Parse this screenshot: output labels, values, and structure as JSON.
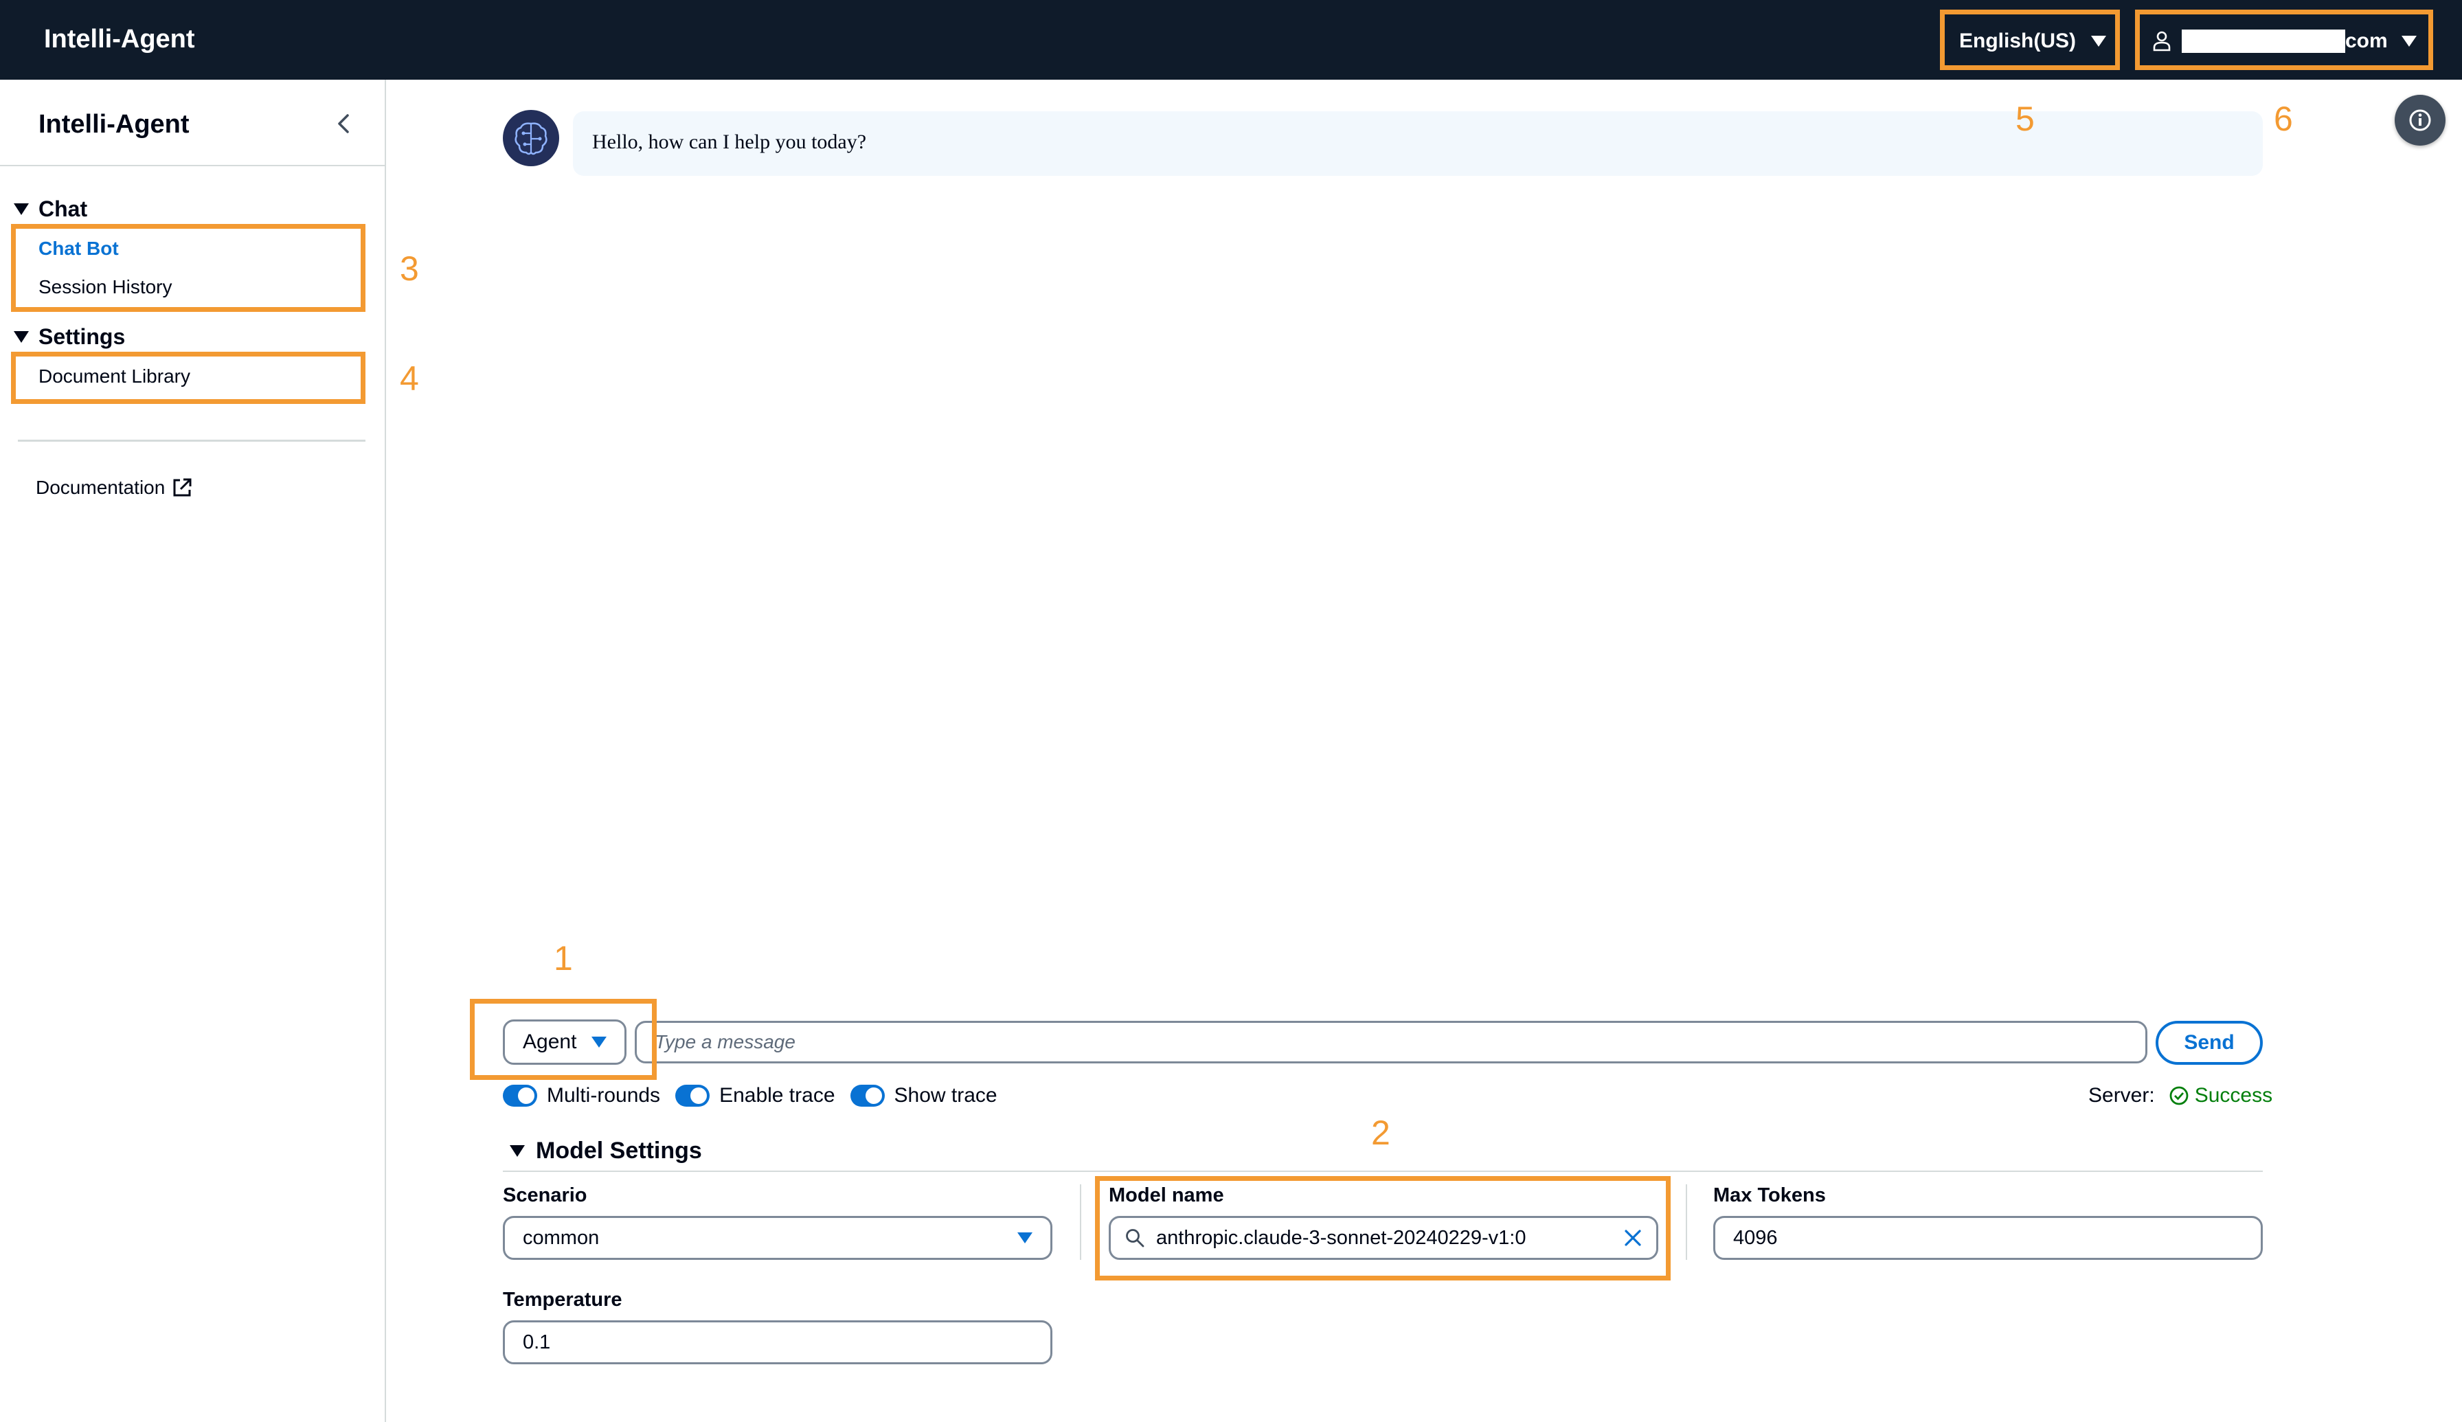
{
  "header": {
    "brand": "Intelli-Agent",
    "language": "English(US)",
    "user_suffix": "com"
  },
  "sidebar": {
    "title": "Intelli-Agent",
    "sections": [
      {
        "label": "Chat",
        "items": [
          {
            "label": "Chat Bot",
            "active": true
          },
          {
            "label": "Session History",
            "active": false
          }
        ]
      },
      {
        "label": "Settings",
        "items": [
          {
            "label": "Document Library",
            "active": false
          }
        ]
      }
    ],
    "documentation": "Documentation"
  },
  "chat": {
    "messages": [
      {
        "role": "assistant",
        "text": "Hello, how can I help you today?"
      }
    ]
  },
  "input": {
    "mode": "Agent",
    "placeholder": "Type a message",
    "send": "Send"
  },
  "toggles": [
    {
      "label": "Multi-rounds",
      "on": true
    },
    {
      "label": "Enable trace",
      "on": true
    },
    {
      "label": "Show trace",
      "on": true
    }
  ],
  "server": {
    "label": "Server:",
    "status": "Success"
  },
  "model_settings": {
    "title": "Model Settings",
    "scenario": {
      "label": "Scenario",
      "value": "common"
    },
    "model_name": {
      "label": "Model name",
      "value": "anthropic.claude-3-sonnet-20240229-v1:0"
    },
    "max_tokens": {
      "label": "Max Tokens",
      "value": "4096"
    },
    "temperature": {
      "label": "Temperature",
      "value": "0.1"
    }
  },
  "annotations": [
    "1",
    "2",
    "3",
    "4",
    "5",
    "6"
  ],
  "colors": {
    "accent": "#0972d3",
    "topbar": "#0f1b2a",
    "annotation": "#f39a32",
    "success": "#037f0c"
  }
}
